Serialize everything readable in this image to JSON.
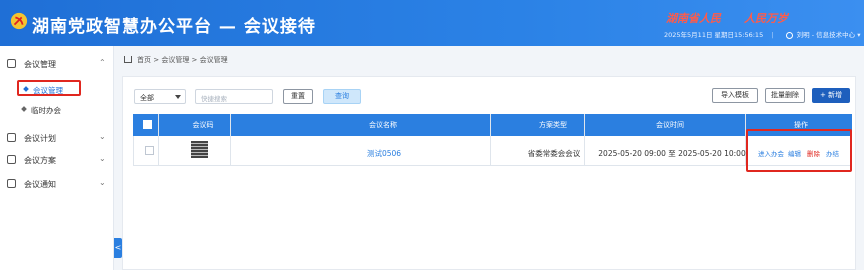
{
  "header": {
    "title": "湖南党政智慧办公平台 — 会议接待",
    "slogans": [
      "湖南省人民",
      "人民万岁"
    ],
    "datetime": "2025年5月11日 星期日15:56:15",
    "user": "刘明 - 信息技术中心",
    "colors": {
      "bar": "#2b82e6",
      "slogan": "#ff5b4a"
    }
  },
  "sidebar": {
    "groups": [
      {
        "label": "会议管理",
        "icon": "meeting-icon",
        "chevron": "^"
      },
      {
        "label": "会议计划",
        "icon": "plan-icon",
        "chevron": "v"
      },
      {
        "label": "会议方案",
        "icon": "scheme-icon",
        "chevron": "v"
      },
      {
        "label": "会议通知",
        "icon": "notice-icon",
        "chevron": "v"
      }
    ],
    "subitems": [
      {
        "label": "会议管理",
        "active": true
      },
      {
        "label": "临时办会",
        "active": false
      }
    ],
    "collapse": "<"
  },
  "breadcrumb": "首页 > 会议管理 > 会议管理",
  "toolbar": {
    "select_value": "全部",
    "search_placeholder": "快捷搜索",
    "reset": "重置",
    "query": "查询",
    "import": "导入模板",
    "batch_delete": "批量删除",
    "add": "+ 新增"
  },
  "table": {
    "headers": [
      "会议码",
      "会议名称",
      "方案类型",
      "会议时间",
      "操作"
    ],
    "rows": [
      {
        "name": "测试0506",
        "type": "省委常委会会议",
        "time": "2025-05-20 09:00 至 2025-05-20 10:00",
        "ops": [
          "进入办会",
          "编辑",
          "删除",
          "办结"
        ]
      }
    ]
  }
}
